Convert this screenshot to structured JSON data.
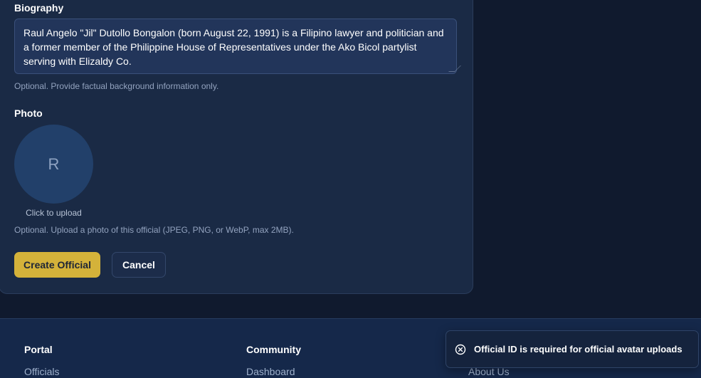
{
  "form": {
    "biography_label": "Biography",
    "biography_value": "Raul Angelo \"Jil\" Dutollo Bongalon (born August 22, 1991) is a Filipino lawyer and politician and a former member of the Philippine House of Representatives under the Ako Bicol partylist serving with Elizaldy Co.",
    "biography_hint": "Optional. Provide factual background information only.",
    "photo_label": "Photo",
    "photo_initial": "R",
    "photo_upload_caption": "Click to upload",
    "photo_hint": "Optional. Upload a photo of this official (JPEG, PNG, or WebP, max 2MB).",
    "create_button": "Create Official",
    "cancel_button": "Cancel"
  },
  "footer": {
    "columns": [
      {
        "heading": "Portal",
        "link": "Officials"
      },
      {
        "heading": "Community",
        "link": "Dashboard"
      },
      {
        "heading": "",
        "link": "About Us"
      }
    ]
  },
  "toast": {
    "icon": "error-circle-x-icon",
    "message": "Official ID is required for official avatar uploads"
  },
  "colors": {
    "page_bg": "#101a2e",
    "card_bg": "#1a2a45",
    "primary_button": "#d4b23a",
    "footer_bg": "#15284a"
  }
}
